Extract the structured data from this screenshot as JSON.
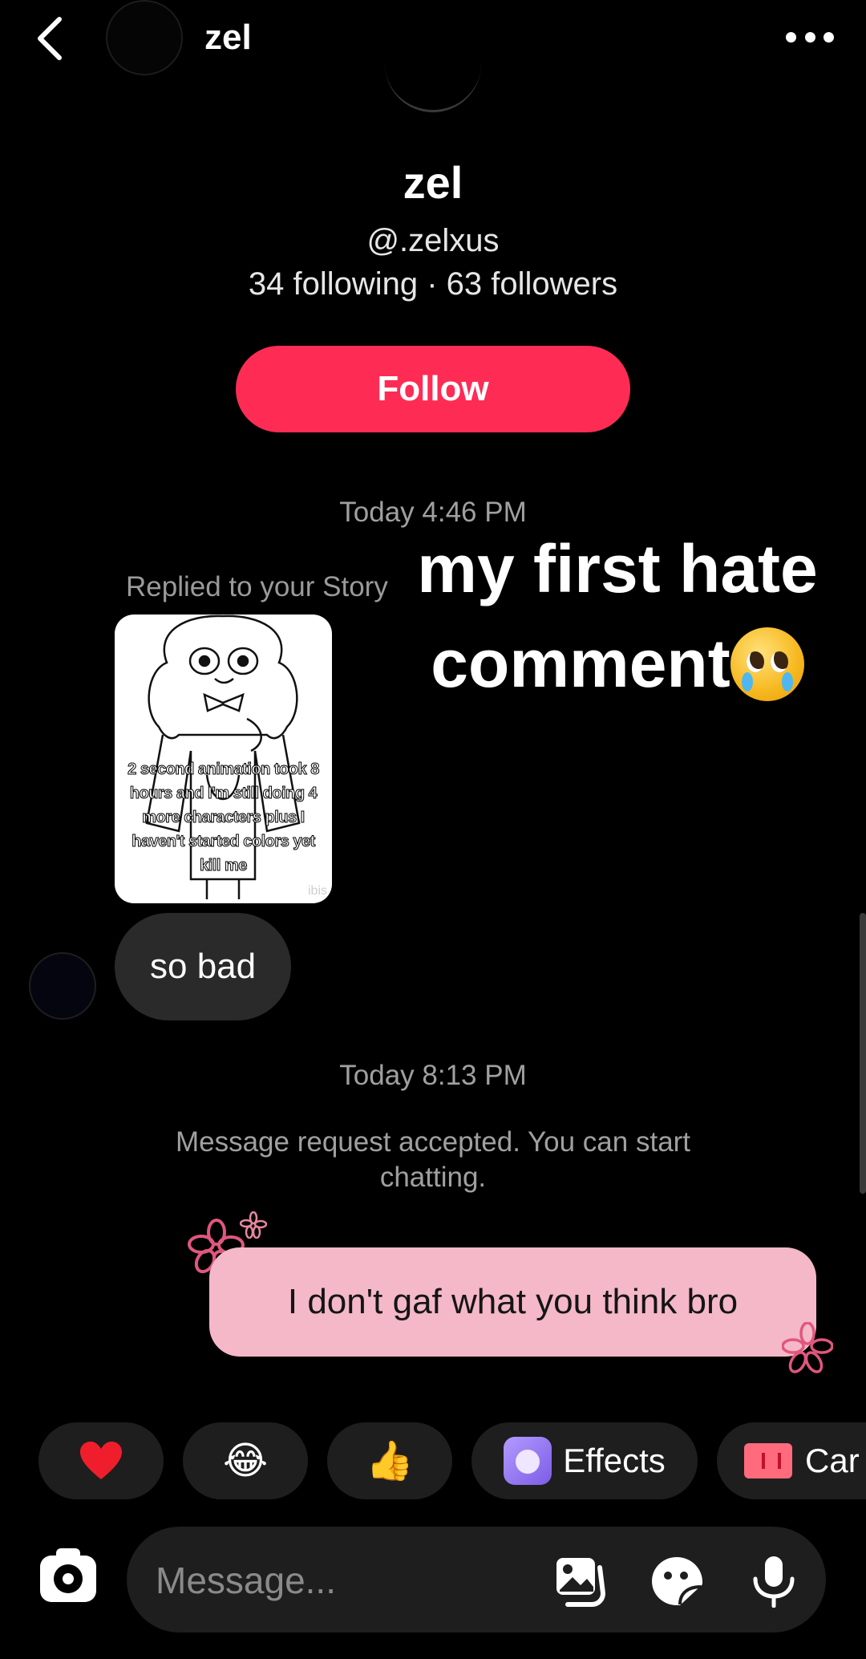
{
  "header": {
    "name": "zel",
    "back_icon": "chevron-left-icon",
    "more_icon": "more-horizontal-icon"
  },
  "profile": {
    "name": "zel",
    "handle": "@.zelxus",
    "stats": "34 following · 63 followers",
    "follow_label": "Follow"
  },
  "conversation": {
    "timestamp_1": "Today 4:46 PM",
    "replied_label": "Replied to your Story",
    "overlay_text": "my first hate comment",
    "overlay_emoji": "pleading-face-with-tears-icon",
    "story_caption": "2 second animation took 8 hours and I'm still doing 4 more characters plus I haven't started colors yet kill me",
    "story_watermark": "ibis",
    "received_message": "so bad",
    "timestamp_2": "Today 8:13 PM",
    "system_message": "Message request accepted. You can start chatting.",
    "sent_message": "I don't gaf what you think bro"
  },
  "quick_reactions": [
    {
      "emoji": "❤",
      "icon": "red-heart-icon"
    },
    {
      "emoji": "😂",
      "icon": "laughing-face-icon"
    },
    {
      "emoji": "👍",
      "icon": "thumbs-up-icon"
    },
    {
      "label": "Effects",
      "icon": "effects-icon"
    },
    {
      "label": "Car",
      "icon": "card-icon"
    }
  ],
  "composer": {
    "placeholder": "Message...",
    "icons": [
      "camera-icon",
      "gallery-icon",
      "sticker-icon",
      "microphone-icon"
    ]
  },
  "colors": {
    "background": "#000000",
    "follow_button": "#fe2c55",
    "received_bubble": "#2a2a2a",
    "sent_bubble": "#f4b8c8",
    "chip_background": "#1e1e1e"
  }
}
